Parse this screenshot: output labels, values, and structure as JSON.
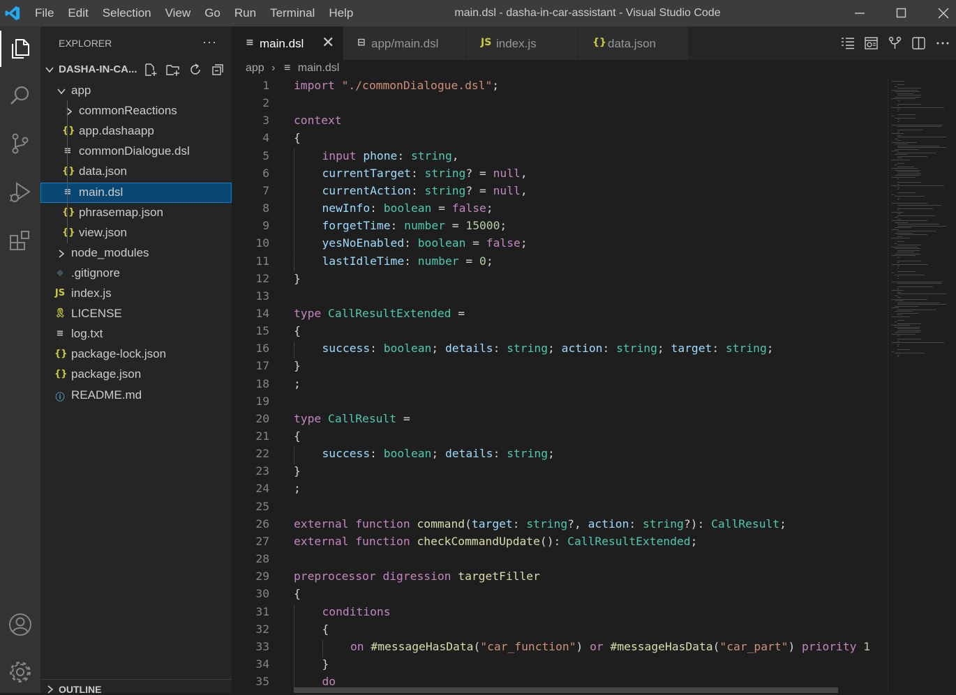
{
  "window": {
    "title": "main.dsl - dasha-in-car-assistant - Visual Studio Code",
    "menu": [
      "File",
      "Edit",
      "Selection",
      "View",
      "Go",
      "Run",
      "Terminal",
      "Help"
    ]
  },
  "colors": {
    "accent": "#007acc",
    "keyword": "#c586c0",
    "string": "#ce9178",
    "type": "#4ec9b0",
    "variable": "#9cdcfe",
    "number": "#b5cea8",
    "function": "#dcdcaa",
    "json_icon": "#cbcb41",
    "dsl_icon": "#c5c5c5",
    "selection": "#094771"
  },
  "activity_bar": [
    "files-icon",
    "search-icon",
    "source-control-icon",
    "run-debug-icon",
    "extensions-icon",
    "account-icon",
    "settings-gear-icon"
  ],
  "sidebar": {
    "header": "EXPLORER",
    "more": "···",
    "folder_name": "DASHA-IN-CA...",
    "toolbar_icons": [
      "new-file-icon",
      "new-folder-icon",
      "refresh-icon",
      "collapse-all-icon"
    ],
    "tree": [
      {
        "label": "app",
        "icon": "chevron-down-icon",
        "glyph": "",
        "depth": 1
      },
      {
        "label": "commonReactions",
        "icon": "chevron-right-icon",
        "glyph": "",
        "depth": 2
      },
      {
        "label": "app.dashaapp",
        "icon": "json-icon",
        "glyph": "{}",
        "depth": 2
      },
      {
        "label": "commonDialogue.dsl",
        "icon": "file-lines-icon",
        "glyph": "≡",
        "depth": 2
      },
      {
        "label": "data.json",
        "icon": "json-icon",
        "glyph": "{}",
        "depth": 2
      },
      {
        "label": "main.dsl",
        "icon": "file-lines-icon",
        "glyph": "≡",
        "depth": 2,
        "selected": true
      },
      {
        "label": "phrasemap.json",
        "icon": "json-icon",
        "glyph": "{}",
        "depth": 2
      },
      {
        "label": "view.json",
        "icon": "json-icon",
        "glyph": "{}",
        "depth": 2
      },
      {
        "label": "node_modules",
        "icon": "chevron-right-icon",
        "glyph": "",
        "depth": 1
      },
      {
        "label": ".gitignore",
        "icon": "git-icon",
        "glyph": "◆",
        "depth": 1
      },
      {
        "label": "index.js",
        "icon": "javascript-icon",
        "glyph": "JS",
        "depth": 1
      },
      {
        "label": "LICENSE",
        "icon": "license-icon",
        "glyph": "🎗",
        "depth": 1
      },
      {
        "label": "log.txt",
        "icon": "file-lines-icon",
        "glyph": "≡",
        "depth": 1
      },
      {
        "label": "package-lock.json",
        "icon": "json-icon",
        "glyph": "{}",
        "depth": 1
      },
      {
        "label": "package.json",
        "icon": "json-icon",
        "glyph": "{}",
        "depth": 1
      },
      {
        "label": "README.md",
        "icon": "info-icon",
        "glyph": "ⓘ",
        "depth": 1
      }
    ],
    "outline_label": "OUTLINE"
  },
  "tabs": [
    {
      "label": "main.dsl",
      "glyph": "≡",
      "icon": "file-lines-icon",
      "active": true
    },
    {
      "label": "app/main.dsl",
      "glyph": "⊟",
      "icon": "open-preview-icon",
      "active": false
    },
    {
      "label": "index.js",
      "glyph": "JS",
      "icon": "javascript-icon",
      "active": false
    },
    {
      "label": "data.json",
      "glyph": "{}",
      "icon": "json-icon",
      "active": false
    }
  ],
  "tab_close": "✕",
  "editor_actions": [
    "outline-view-icon",
    "open-preview-icon",
    "compare-icon",
    "split-editor-icon",
    "more-actions-icon"
  ],
  "breadcrumb": {
    "folder": "app",
    "separator": "›",
    "file": "main.dsl",
    "file_glyph": "≡"
  },
  "code": [
    {
      "n": "1",
      "indent": 0,
      "tokens": [
        [
          "import ",
          "k"
        ],
        [
          "\"./commonDialogue.dsl\"",
          "s"
        ],
        [
          ";",
          ""
        ]
      ]
    },
    {
      "n": "2",
      "indent": 0,
      "tokens": []
    },
    {
      "n": "3",
      "indent": 0,
      "tokens": [
        [
          "context",
          "k"
        ]
      ]
    },
    {
      "n": "4",
      "indent": 0,
      "tokens": [
        [
          "{",
          ""
        ]
      ]
    },
    {
      "n": "5",
      "indent": 1,
      "tokens": [
        [
          "input ",
          "k"
        ],
        [
          "phone",
          "v"
        ],
        [
          ": ",
          ""
        ],
        [
          "string",
          "t"
        ],
        [
          ",",
          ""
        ]
      ]
    },
    {
      "n": "6",
      "indent": 1,
      "tokens": [
        [
          "currentTarget",
          "v"
        ],
        [
          ": ",
          ""
        ],
        [
          "string",
          "t"
        ],
        [
          "? = ",
          ""
        ],
        [
          "null",
          "k"
        ],
        [
          ",",
          ""
        ]
      ]
    },
    {
      "n": "7",
      "indent": 1,
      "tokens": [
        [
          "currentAction",
          "v"
        ],
        [
          ": ",
          ""
        ],
        [
          "string",
          "t"
        ],
        [
          "? = ",
          ""
        ],
        [
          "null",
          "k"
        ],
        [
          ",",
          ""
        ]
      ]
    },
    {
      "n": "8",
      "indent": 1,
      "tokens": [
        [
          "newInfo",
          "v"
        ],
        [
          ": ",
          ""
        ],
        [
          "boolean",
          "t"
        ],
        [
          " = ",
          ""
        ],
        [
          "false",
          "k"
        ],
        [
          ";",
          ""
        ]
      ]
    },
    {
      "n": "9",
      "indent": 1,
      "tokens": [
        [
          "forgetTime",
          "v"
        ],
        [
          ": ",
          ""
        ],
        [
          "number",
          "t"
        ],
        [
          " = ",
          ""
        ],
        [
          "15000",
          "n"
        ],
        [
          ";",
          ""
        ]
      ]
    },
    {
      "n": "10",
      "indent": 1,
      "tokens": [
        [
          "yesNoEnabled",
          "v"
        ],
        [
          ": ",
          ""
        ],
        [
          "boolean",
          "t"
        ],
        [
          " = ",
          ""
        ],
        [
          "false",
          "k"
        ],
        [
          ";",
          ""
        ]
      ]
    },
    {
      "n": "11",
      "indent": 1,
      "tokens": [
        [
          "lastIdleTime",
          "v"
        ],
        [
          ": ",
          ""
        ],
        [
          "number",
          "t"
        ],
        [
          " = ",
          ""
        ],
        [
          "0",
          "n"
        ],
        [
          ";",
          ""
        ]
      ]
    },
    {
      "n": "12",
      "indent": 0,
      "tokens": [
        [
          "}",
          ""
        ]
      ]
    },
    {
      "n": "13",
      "indent": 0,
      "tokens": []
    },
    {
      "n": "14",
      "indent": 0,
      "tokens": [
        [
          "type ",
          "k"
        ],
        [
          "CallResultExtended",
          "t"
        ],
        [
          " =",
          ""
        ]
      ]
    },
    {
      "n": "15",
      "indent": 0,
      "tokens": [
        [
          "{",
          ""
        ]
      ]
    },
    {
      "n": "16",
      "indent": 1,
      "tokens": [
        [
          "success",
          "v"
        ],
        [
          ": ",
          ""
        ],
        [
          "boolean",
          "t"
        ],
        [
          "; ",
          ""
        ],
        [
          "details",
          "v"
        ],
        [
          ": ",
          ""
        ],
        [
          "string",
          "t"
        ],
        [
          "; ",
          ""
        ],
        [
          "action",
          "v"
        ],
        [
          ": ",
          ""
        ],
        [
          "string",
          "t"
        ],
        [
          "; ",
          ""
        ],
        [
          "target",
          "v"
        ],
        [
          ": ",
          ""
        ],
        [
          "string",
          "t"
        ],
        [
          ";",
          ""
        ]
      ]
    },
    {
      "n": "17",
      "indent": 0,
      "tokens": [
        [
          "}",
          ""
        ]
      ]
    },
    {
      "n": "18",
      "indent": 0,
      "tokens": [
        [
          ";",
          ""
        ]
      ]
    },
    {
      "n": "19",
      "indent": 0,
      "tokens": []
    },
    {
      "n": "20",
      "indent": 0,
      "tokens": [
        [
          "type ",
          "k"
        ],
        [
          "CallResult",
          "t"
        ],
        [
          " =",
          ""
        ]
      ]
    },
    {
      "n": "21",
      "indent": 0,
      "tokens": [
        [
          "{",
          ""
        ]
      ]
    },
    {
      "n": "22",
      "indent": 1,
      "tokens": [
        [
          "success",
          "v"
        ],
        [
          ": ",
          ""
        ],
        [
          "boolean",
          "t"
        ],
        [
          "; ",
          ""
        ],
        [
          "details",
          "v"
        ],
        [
          ": ",
          ""
        ],
        [
          "string",
          "t"
        ],
        [
          ";",
          ""
        ]
      ]
    },
    {
      "n": "23",
      "indent": 0,
      "tokens": [
        [
          "}",
          ""
        ]
      ]
    },
    {
      "n": "24",
      "indent": 0,
      "tokens": [
        [
          ";",
          ""
        ]
      ]
    },
    {
      "n": "25",
      "indent": 0,
      "tokens": []
    },
    {
      "n": "26",
      "indent": 0,
      "tokens": [
        [
          "external ",
          "k"
        ],
        [
          "function ",
          "k"
        ],
        [
          "command",
          "f"
        ],
        [
          "(",
          ""
        ],
        [
          "target",
          "v"
        ],
        [
          ": ",
          ""
        ],
        [
          "string",
          "t"
        ],
        [
          "?, ",
          ""
        ],
        [
          "action",
          "v"
        ],
        [
          ": ",
          ""
        ],
        [
          "string",
          "t"
        ],
        [
          "?): ",
          ""
        ],
        [
          "CallResult",
          "t"
        ],
        [
          ";",
          ""
        ]
      ]
    },
    {
      "n": "27",
      "indent": 0,
      "tokens": [
        [
          "external ",
          "k"
        ],
        [
          "function ",
          "k"
        ],
        [
          "checkCommandUpdate",
          "f"
        ],
        [
          "(): ",
          ""
        ],
        [
          "CallResultExtended",
          "t"
        ],
        [
          ";",
          ""
        ]
      ]
    },
    {
      "n": "28",
      "indent": 0,
      "tokens": []
    },
    {
      "n": "29",
      "indent": 0,
      "tokens": [
        [
          "preprocessor ",
          "k"
        ],
        [
          "digression ",
          "k"
        ],
        [
          "targetFiller",
          "f"
        ]
      ]
    },
    {
      "n": "30",
      "indent": 0,
      "tokens": [
        [
          "{",
          ""
        ]
      ]
    },
    {
      "n": "31",
      "indent": 1,
      "tokens": [
        [
          "conditions",
          "k"
        ]
      ]
    },
    {
      "n": "32",
      "indent": 1,
      "tokens": [
        [
          "{",
          ""
        ]
      ]
    },
    {
      "n": "33",
      "indent": 2,
      "tokens": [
        [
          "on ",
          "k"
        ],
        [
          "#messageHasData",
          "f"
        ],
        [
          "(",
          ""
        ],
        [
          "\"car_function\"",
          "s"
        ],
        [
          ") ",
          ""
        ],
        [
          "or ",
          "k"
        ],
        [
          "#messageHasData",
          "f"
        ],
        [
          "(",
          ""
        ],
        [
          "\"car_part\"",
          "s"
        ],
        [
          ") ",
          ""
        ],
        [
          "priority ",
          "k"
        ],
        [
          "1",
          "n"
        ]
      ]
    },
    {
      "n": "34",
      "indent": 1,
      "tokens": [
        [
          "}",
          ""
        ]
      ]
    },
    {
      "n": "35",
      "indent": 1,
      "tokens": [
        [
          "do",
          "k"
        ]
      ]
    }
  ]
}
